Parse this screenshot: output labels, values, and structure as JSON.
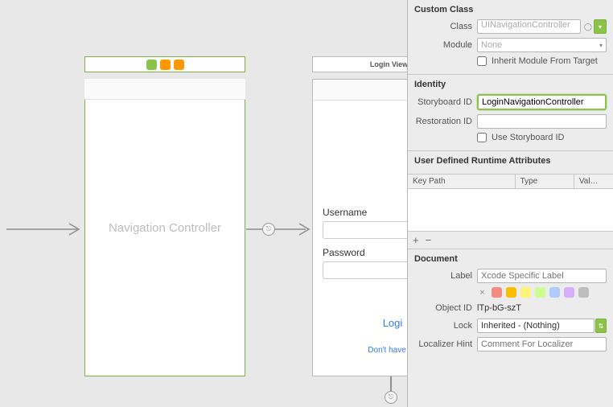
{
  "canvas": {
    "nav_controller": {
      "title": "Navigation Controller"
    },
    "login_scene": {
      "header": "Login View C",
      "username_label": "Username",
      "password_label": "Password",
      "login_link": "Logi",
      "signup_link": "Don't have an"
    }
  },
  "inspector": {
    "custom_class": {
      "section_title": "Custom Class",
      "class_label": "Class",
      "class_value": "UINavigationController",
      "module_label": "Module",
      "module_value": "None",
      "inherit_label": "Inherit Module From Target"
    },
    "identity": {
      "section_title": "Identity",
      "storyboard_id_label": "Storyboard ID",
      "storyboard_id_value": "LoginNavigationController",
      "restoration_id_label": "Restoration ID",
      "restoration_id_value": "",
      "use_storyboard_label": "Use Storyboard ID"
    },
    "runtime_attrs": {
      "section_title": "User Defined Runtime Attributes",
      "col_keypath": "Key Path",
      "col_type": "Type",
      "col_value": "Val…",
      "add": "+",
      "remove": "−"
    },
    "document": {
      "section_title": "Document",
      "label_label": "Label",
      "label_placeholder": "Xcode Specific Label",
      "object_id_label": "Object ID",
      "object_id_value": "lTp-bG-szT",
      "lock_label": "Lock",
      "lock_value": "Inherited - (Nothing)",
      "localizer_label": "Localizer Hint",
      "localizer_placeholder": "Comment For Localizer"
    }
  }
}
